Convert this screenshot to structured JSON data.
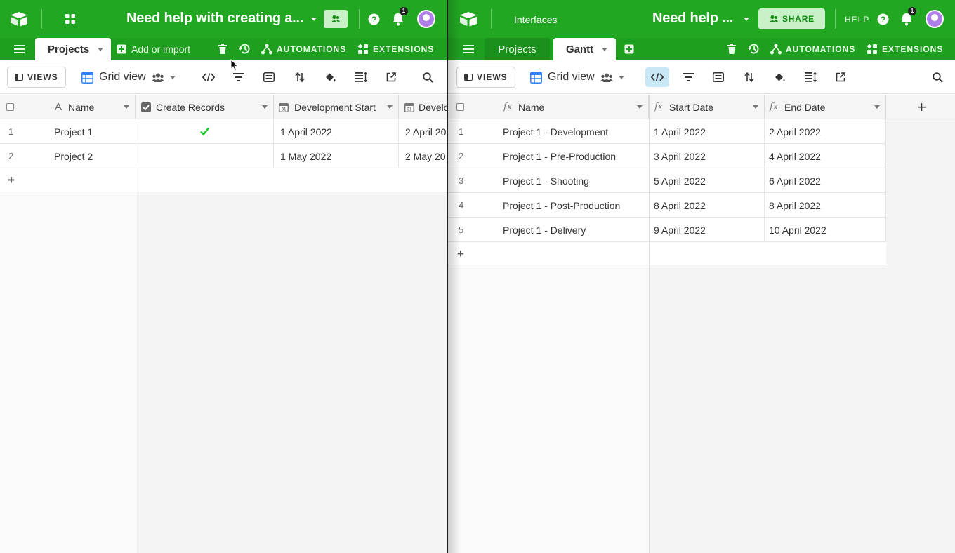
{
  "left": {
    "base_title": "Need help with creating a...",
    "badge_count": "1",
    "tabs": {
      "active": "Projects",
      "add_label": "Add or import"
    },
    "actions": {
      "automations": "AUTOMATIONS",
      "extensions": "EXTENSIONS"
    },
    "views_label": "VIEWS",
    "view_name": "Grid view",
    "columns": [
      "Name",
      "Create Records",
      "Development Start",
      "Develo"
    ],
    "rows": [
      {
        "num": "1",
        "name": "Project 1",
        "create_records": true,
        "dev_start": "1 April 2022",
        "dev_end": "2 April 20"
      },
      {
        "num": "2",
        "name": "Project 2",
        "create_records": false,
        "dev_start": "1 May 2022",
        "dev_end": "2 May 20"
      }
    ],
    "add_row": "+"
  },
  "right": {
    "interfaces_label": "Interfaces",
    "base_title": "Need help ...",
    "share_label": "SHARE",
    "help_label": "HELP",
    "badge_count": "1",
    "tabs": [
      {
        "label": "Projects",
        "active": false
      },
      {
        "label": "Gantt",
        "active": true
      }
    ],
    "actions": {
      "automations": "AUTOMATIONS",
      "extensions": "EXTENSIONS"
    },
    "views_label": "VIEWS",
    "view_name": "Grid view",
    "columns": [
      "Name",
      "Start Date",
      "End Date"
    ],
    "add_column": "+",
    "rows": [
      {
        "num": "1",
        "name": "Project 1 - Development",
        "start": "1 April 2022",
        "end": "2 April 2022"
      },
      {
        "num": "2",
        "name": "Project 1 - Pre-Production",
        "start": "3 April 2022",
        "end": "4 April 2022"
      },
      {
        "num": "3",
        "name": "Project 1 - Shooting",
        "start": "5 April 2022",
        "end": "6 April 2022"
      },
      {
        "num": "4",
        "name": "Project 1 - Post-Production",
        "start": "8 April 2022",
        "end": "8 April 2022"
      },
      {
        "num": "5",
        "name": "Project 1 - Delivery",
        "start": "9 April 2022",
        "end": "10 April 2022"
      }
    ],
    "add_row": "+"
  },
  "colors": {
    "brand_green": "#22a722",
    "tab_green": "#1f9f1f",
    "check_green": "#20c933",
    "share_bg": "#c8f1c8"
  }
}
